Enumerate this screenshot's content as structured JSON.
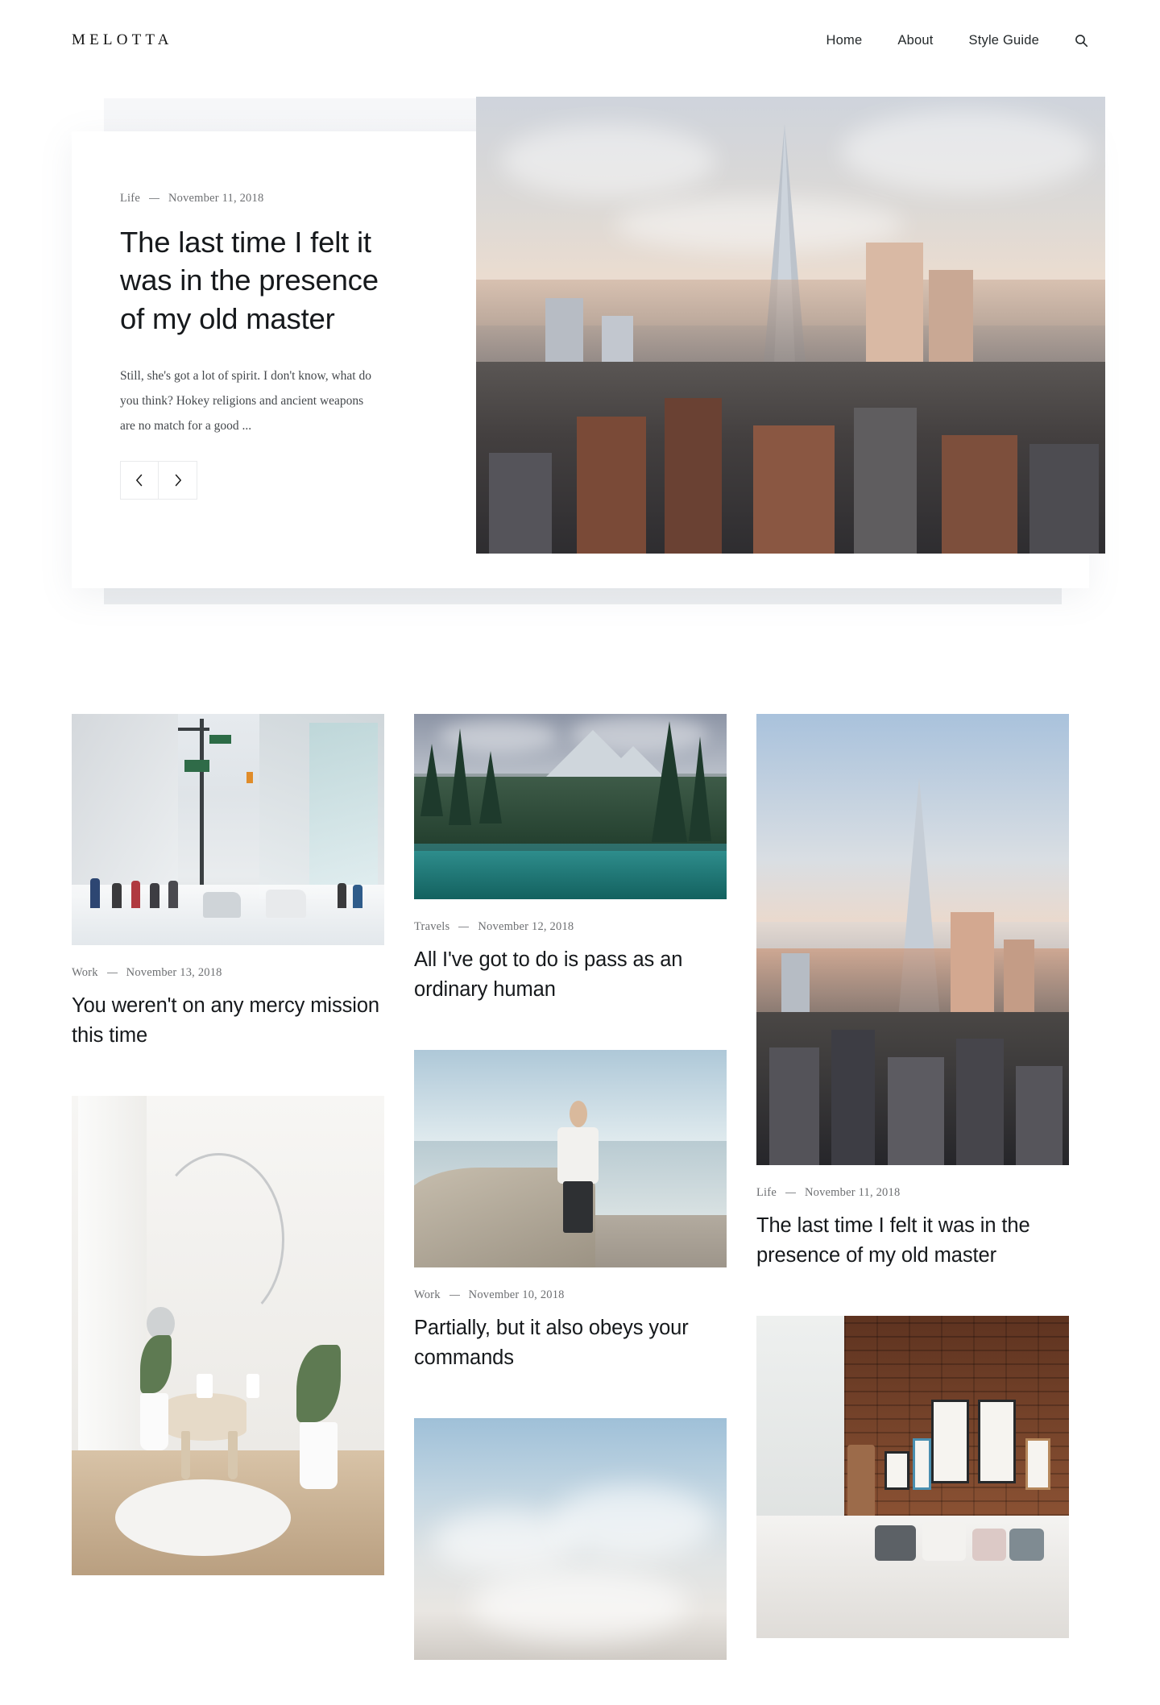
{
  "site": {
    "logo": "MELOTTA"
  },
  "nav": {
    "items": [
      {
        "label": "Home"
      },
      {
        "label": "About"
      },
      {
        "label": "Style Guide"
      }
    ],
    "search_icon": "search-icon"
  },
  "hero": {
    "category": "Life",
    "separator": "—",
    "date": "November 11, 2018",
    "title": "The last time I felt it was in the presence of my old master",
    "excerpt": "Still, she's got a lot of spirit. I don't know, what do you think? Hokey religions and ancient weapons are no match for a good ...",
    "prev_label": "‹",
    "next_label": "›",
    "image_alt": "city-skyline-photo"
  },
  "grid": {
    "columns": [
      {
        "cards": [
          {
            "image_alt": "snowy-city-street-photo",
            "category": "Work",
            "separator": "—",
            "date": "November 13, 2018",
            "title": "You weren't on any mercy mission this time"
          },
          {
            "image_alt": "white-interior-room-photo",
            "category": "",
            "separator": "",
            "date": "",
            "title": ""
          }
        ]
      },
      {
        "cards": [
          {
            "image_alt": "mountain-lake-forest-photo",
            "category": "Travels",
            "separator": "—",
            "date": "November 12, 2018",
            "title": "All I've got to do is pass as an ordinary human"
          },
          {
            "image_alt": "photographer-on-beach-photo",
            "category": "Work",
            "separator": "—",
            "date": "November 10, 2018",
            "title": "Partially, but it also obeys your commands"
          },
          {
            "image_alt": "clouds-sky-photo",
            "category": "",
            "separator": "",
            "date": "",
            "title": ""
          }
        ]
      },
      {
        "cards": [
          {
            "image_alt": "shard-london-skyline-photo",
            "category": "Life",
            "separator": "—",
            "date": "November 11, 2018",
            "title": "The last time I felt it was in the presence of my old master"
          },
          {
            "image_alt": "bedroom-brick-wall-photo",
            "category": "",
            "separator": "",
            "date": "",
            "title": ""
          }
        ]
      }
    ]
  },
  "colors": {
    "text": "#16191c",
    "meta": "#6d6f72",
    "band": "#f2f3f5",
    "border": "#e9eaec"
  }
}
